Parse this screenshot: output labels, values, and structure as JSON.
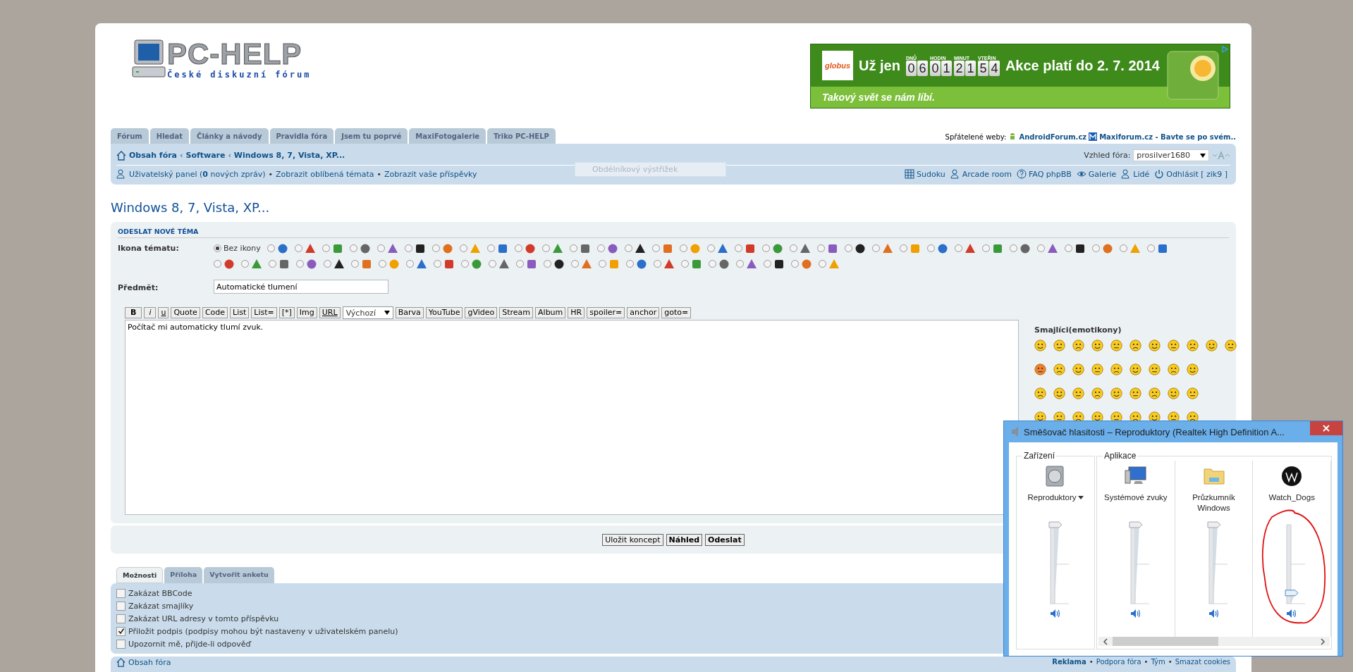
{
  "logo": {
    "title": "PC-HELP",
    "subtitle": "České diskuzní fórum"
  },
  "ad": {
    "brand": "globus",
    "lead": "Už jen",
    "units": [
      "DNŮ",
      "HODIN",
      "MINUT",
      "VTEŘIN"
    ],
    "digits": [
      "0",
      "6",
      "0",
      "1",
      "2",
      "1",
      "5",
      "4"
    ],
    "offer": "Akce platí do 2. 7. 2014",
    "slogan": "Takový svět se nám líbí."
  },
  "tabs": [
    {
      "label": "Fórum"
    },
    {
      "label": "Hledat"
    },
    {
      "label": "Články a návody"
    },
    {
      "label": "Pravidla fóra"
    },
    {
      "label": "Jsem tu poprvé"
    },
    {
      "label": "MaxiFotogalerie"
    },
    {
      "label": "Triko PC-HELP"
    }
  ],
  "friends": {
    "label": "Spřátelené weby:",
    "links": [
      "AndroidForum.cz",
      "Maxiforum.cz - Bavte se po svém.."
    ]
  },
  "ghost_tooltip": "Obdélníkový výstřižek",
  "breadcrumbs": [
    "Obsah fóra",
    "Software",
    "Windows 8, 7, Vista, XP..."
  ],
  "breadcrumb_separator": "‹",
  "bullet": "•",
  "style_select": {
    "label": "Vzhled fóra:",
    "value": "prosilver1680"
  },
  "user_links": [
    "Uživatelský panel (**0** nových zpráv)",
    "Zobrazit oblíbená témata",
    "Zobrazit vaše příspěvky"
  ],
  "right_links": [
    "Sudoku",
    "Arcade room",
    "FAQ phpBB",
    "Galerie",
    "Lidé",
    "Odhlásit [ zik9 ]"
  ],
  "page_title": "Windows 8, 7, Vista, XP...",
  "post": {
    "heading": "ODESLAT NOVÉ TÉMA",
    "icon_label": "Ikona tématu:",
    "icons": [
      {
        "label": "Bez ikony",
        "selected": true
      },
      {
        "selected": false
      },
      {
        "selected": false
      },
      {
        "selected": false
      },
      {
        "selected": false
      },
      {
        "selected": false
      },
      {
        "selected": false
      },
      {
        "selected": false
      },
      {
        "selected": false
      },
      {
        "selected": false
      },
      {
        "selected": false
      },
      {
        "selected": false
      },
      {
        "selected": false
      },
      {
        "selected": false
      },
      {
        "selected": false
      },
      {
        "selected": false
      },
      {
        "selected": false
      },
      {
        "selected": false
      },
      {
        "selected": false
      },
      {
        "selected": false
      },
      {
        "selected": false
      },
      {
        "selected": false
      },
      {
        "selected": false
      },
      {
        "selected": false
      },
      {
        "selected": false
      },
      {
        "selected": false
      },
      {
        "selected": false
      },
      {
        "selected": false
      },
      {
        "selected": false
      },
      {
        "selected": false
      },
      {
        "selected": false
      },
      {
        "selected": false
      },
      {
        "selected": false
      },
      {
        "selected": false
      },
      {
        "selected": false
      },
      {
        "selected": false
      },
      {
        "selected": false
      },
      {
        "selected": false
      },
      {
        "selected": false
      },
      {
        "selected": false
      },
      {
        "selected": false
      },
      {
        "selected": false
      },
      {
        "selected": false
      },
      {
        "selected": false
      },
      {
        "selected": false
      },
      {
        "selected": false
      },
      {
        "selected": false
      },
      {
        "selected": false
      },
      {
        "selected": false
      },
      {
        "selected": false
      },
      {
        "selected": false
      },
      {
        "selected": false
      },
      {
        "selected": false
      },
      {
        "selected": false
      },
      {
        "selected": false
      },
      {
        "selected": false
      },
      {
        "selected": false
      }
    ],
    "subject_label": "Předmět:",
    "subject": "Automatické tlumení",
    "toolbar": [
      {
        "label": "B",
        "kind": "button"
      },
      {
        "label": "i",
        "kind": "button"
      },
      {
        "label": "u",
        "kind": "button"
      },
      {
        "label": "Quote",
        "kind": "button"
      },
      {
        "label": "Code",
        "kind": "button"
      },
      {
        "label": "List",
        "kind": "button"
      },
      {
        "label": "List=",
        "kind": "button"
      },
      {
        "label": "[*]",
        "kind": "button"
      },
      {
        "label": "Img",
        "kind": "button"
      },
      {
        "label": "URL",
        "kind": "button"
      },
      {
        "label": "Výchozí",
        "kind": "select"
      },
      {
        "label": "Barva",
        "kind": "button"
      },
      {
        "label": "YouTube",
        "kind": "button"
      },
      {
        "label": "gVideo",
        "kind": "button"
      },
      {
        "label": "Stream",
        "kind": "button"
      },
      {
        "label": "Album",
        "kind": "button"
      },
      {
        "label": "HR",
        "kind": "button"
      },
      {
        "label": "spoiler=",
        "kind": "button"
      },
      {
        "label": "anchor",
        "kind": "button"
      },
      {
        "label": "goto=",
        "kind": "button"
      }
    ],
    "message": "Počítač mi automaticky tlumí zvuk.",
    "smilies_title": "Smajlíci(emotikony)"
  },
  "actions": [
    {
      "label": "Uložit koncept",
      "primary": false
    },
    {
      "label": "Náhled",
      "primary": true
    },
    {
      "label": "Odeslat",
      "primary": true
    }
  ],
  "option_tabs": [
    {
      "label": "Možnosti",
      "selected": true
    },
    {
      "label": "Příloha",
      "selected": false
    },
    {
      "label": "Vytvořit anketu",
      "selected": false
    }
  ],
  "options": [
    {
      "label": "Zakázat BBCode",
      "checked": false
    },
    {
      "label": "Zakázat smajlíky",
      "checked": false
    },
    {
      "label": "Zakázat URL adresy v tomto příspěvku",
      "checked": false
    },
    {
      "label": "Přiložit podpis (podpisy mohou být nastaveny v uživatelském panelu)",
      "checked": true
    },
    {
      "label": "Upozornit mě, přijde-li odpověď",
      "checked": false
    }
  ],
  "footer": {
    "home": "Obsah fóra",
    "links": [
      "Reklama",
      "Podpora fóra",
      "Tým",
      "Smazat cookies"
    ]
  },
  "mixer": {
    "title": "Směšovač hlasitosti – Reproduktory (Realtek High Definition A...",
    "device_group": "Zařízení",
    "apps_group": "Aplikace",
    "channels": [
      {
        "name": "Reproduktory",
        "kind": "device",
        "level": 1
      },
      {
        "name": "Systémové zvuky",
        "kind": "app",
        "level": 1
      },
      {
        "name": "Průzkumník Windows",
        "kind": "app",
        "level": 1
      },
      {
        "name": "Watch_Dogs",
        "kind": "app",
        "level": 0.12
      }
    ]
  }
}
